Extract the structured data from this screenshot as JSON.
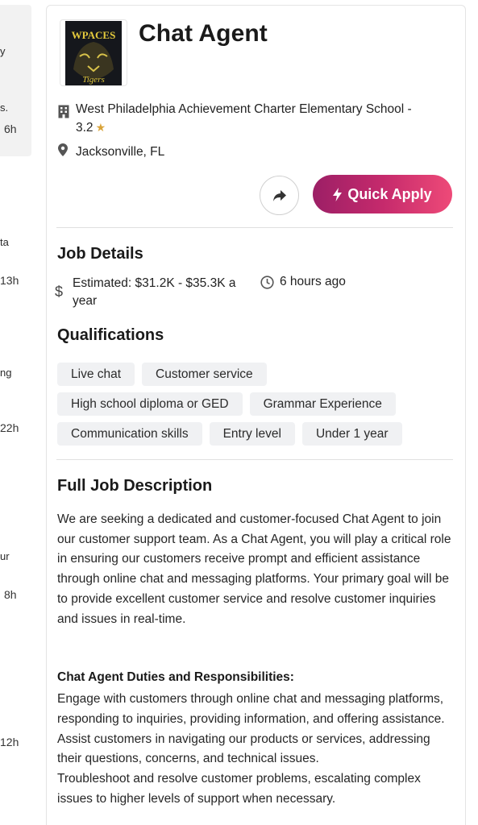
{
  "left_list": {
    "fragments": [
      "y",
      "s.",
      "6h",
      "ta",
      "13h",
      "ng",
      "22h",
      "ur",
      "8h",
      "12h"
    ]
  },
  "job": {
    "title": "Chat Agent",
    "company_line1": "West Philadelphia Achievement Charter Elementary School -",
    "rating": "3.2",
    "location": "Jacksonville, FL",
    "logo_text": "WPACES Tigers"
  },
  "actions": {
    "share_icon": "share-arrow-icon",
    "apply_label": "Quick Apply",
    "apply_gradient": [
      "#9c1f66",
      "#ee4a78"
    ]
  },
  "details": {
    "heading": "Job Details",
    "pay": "Estimated: $31.2K - $35.3K a year",
    "posted": "6 hours ago"
  },
  "qualifications": {
    "heading": "Qualifications",
    "items": [
      "Live chat",
      "Customer service",
      "High school diploma or GED",
      "Grammar Experience",
      "Communication skills",
      "Entry level",
      "Under 1 year"
    ]
  },
  "description": {
    "heading": "Full Job Description",
    "intro": "We are seeking a dedicated and customer-focused Chat Agent to join our customer support team. As a Chat Agent, you will play a critical role in ensuring our customers receive prompt and efficient assistance through online chat and messaging platforms. Your primary goal will be to provide excellent customer service and resolve customer inquiries and issues in real-time.",
    "duties_heading": "Chat Agent Duties and Responsibilities:",
    "duties": [
      "Engage with customers through online chat and messaging platforms, responding to inquiries, providing information, and offering assistance.",
      "Assist customers in navigating our products or services, addressing their questions, concerns, and technical issues.",
      "Troubleshoot and resolve customer problems, escalating complex issues to higher levels of support when necessary."
    ]
  }
}
